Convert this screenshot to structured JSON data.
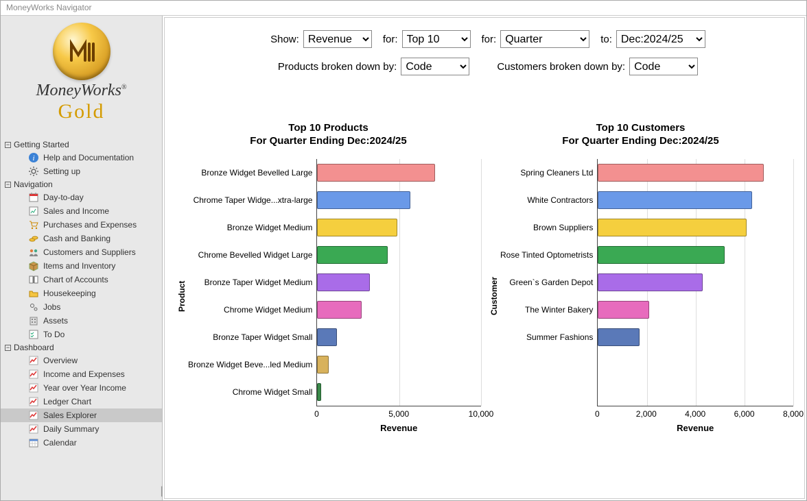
{
  "window_title": "MoneyWorks Navigator",
  "brand": "MoneyWorks",
  "edition": "Gold",
  "sidebar": {
    "groups": [
      {
        "label": "Getting Started",
        "items": [
          {
            "label": "Help and Documentation",
            "icon": "info-icon"
          },
          {
            "label": "Setting up",
            "icon": "gear-icon"
          }
        ]
      },
      {
        "label": "Navigation",
        "items": [
          {
            "label": "Day-to-day",
            "icon": "calendar-icon"
          },
          {
            "label": "Sales and Income",
            "icon": "report-icon"
          },
          {
            "label": "Purchases and Expenses",
            "icon": "cart-icon"
          },
          {
            "label": "Cash and Banking",
            "icon": "coins-icon"
          },
          {
            "label": "Customers and Suppliers",
            "icon": "people-icon"
          },
          {
            "label": "Items and Inventory",
            "icon": "box-icon"
          },
          {
            "label": "Chart of Accounts",
            "icon": "book-icon"
          },
          {
            "label": "Housekeeping",
            "icon": "folder-icon"
          },
          {
            "label": "Jobs",
            "icon": "gears-icon"
          },
          {
            "label": "Assets",
            "icon": "building-icon"
          },
          {
            "label": "To Do",
            "icon": "checklist-icon"
          }
        ]
      },
      {
        "label": "Dashboard",
        "items": [
          {
            "label": "Overview",
            "icon": "chart-icon"
          },
          {
            "label": "Income and Expenses",
            "icon": "chart-icon"
          },
          {
            "label": "Year over Year Income",
            "icon": "chart-icon"
          },
          {
            "label": "Ledger Chart",
            "icon": "chart-icon"
          },
          {
            "label": "Sales Explorer",
            "icon": "chart-icon",
            "selected": true
          },
          {
            "label": "Daily Summary",
            "icon": "chart-icon"
          },
          {
            "label": "Calendar",
            "icon": "calendar-grid-icon"
          }
        ]
      }
    ]
  },
  "filters": {
    "show_label": "Show:",
    "show_value": "Revenue",
    "for1_label": "for:",
    "for1_value": "Top 10",
    "for2_label": "for:",
    "for2_value": "Quarter",
    "to_label": "to:",
    "to_value": "Dec:2024/25",
    "products_label": "Products broken down by:",
    "products_value": "Code",
    "customers_label": "Customers broken down by:",
    "customers_value": "Code"
  },
  "chart_data": [
    {
      "type": "bar",
      "orientation": "horizontal",
      "title": "Top 10 Products\nFor Quarter Ending Dec:2024/25",
      "xlabel": "Revenue",
      "ylabel": "Product",
      "xlim": [
        0,
        10000
      ],
      "xticks": [
        0,
        5000,
        10000
      ],
      "xtick_labels": [
        "0",
        "5,000",
        "10,000"
      ],
      "categories": [
        "Bronze Widget Bevelled Large",
        "Chrome Taper Widge...xtra-large",
        "Bronze Widget Medium",
        "Chrome Bevelled Widget Large",
        "Bronze Taper Widget Medium",
        "Chrome Widget Medium",
        "Bronze Taper Widget Small",
        "Bronze Widget Beve...led Medium",
        "Chrome Widget Small"
      ],
      "values": [
        7200,
        5700,
        4900,
        4300,
        3200,
        2700,
        1200,
        700,
        250
      ],
      "colors": [
        "#f39090",
        "#6a99e8",
        "#f5cf3e",
        "#3aa953",
        "#a96ce8",
        "#e76bbd",
        "#5a79b8",
        "#d8b25c",
        "#3a8a4a"
      ]
    },
    {
      "type": "bar",
      "orientation": "horizontal",
      "title": "Top 10 Customers\nFor Quarter Ending Dec:2024/25",
      "xlabel": "Revenue",
      "ylabel": "Customer",
      "xlim": [
        0,
        8000
      ],
      "xticks": [
        0,
        2000,
        4000,
        6000,
        8000
      ],
      "xtick_labels": [
        "0",
        "2,000",
        "4,000",
        "6,000",
        "8,000"
      ],
      "categories": [
        "Spring Cleaners Ltd",
        "White Contractors",
        "Brown Suppliers",
        "Rose Tinted Optometrists",
        "Green`s Garden Depot",
        "The Winter Bakery",
        "Summer Fashions"
      ],
      "values": [
        6800,
        6300,
        6100,
        5200,
        4300,
        2100,
        1700
      ],
      "colors": [
        "#f39090",
        "#6a99e8",
        "#f5cf3e",
        "#3aa953",
        "#a96ce8",
        "#e76bbd",
        "#5a79b8"
      ]
    }
  ]
}
